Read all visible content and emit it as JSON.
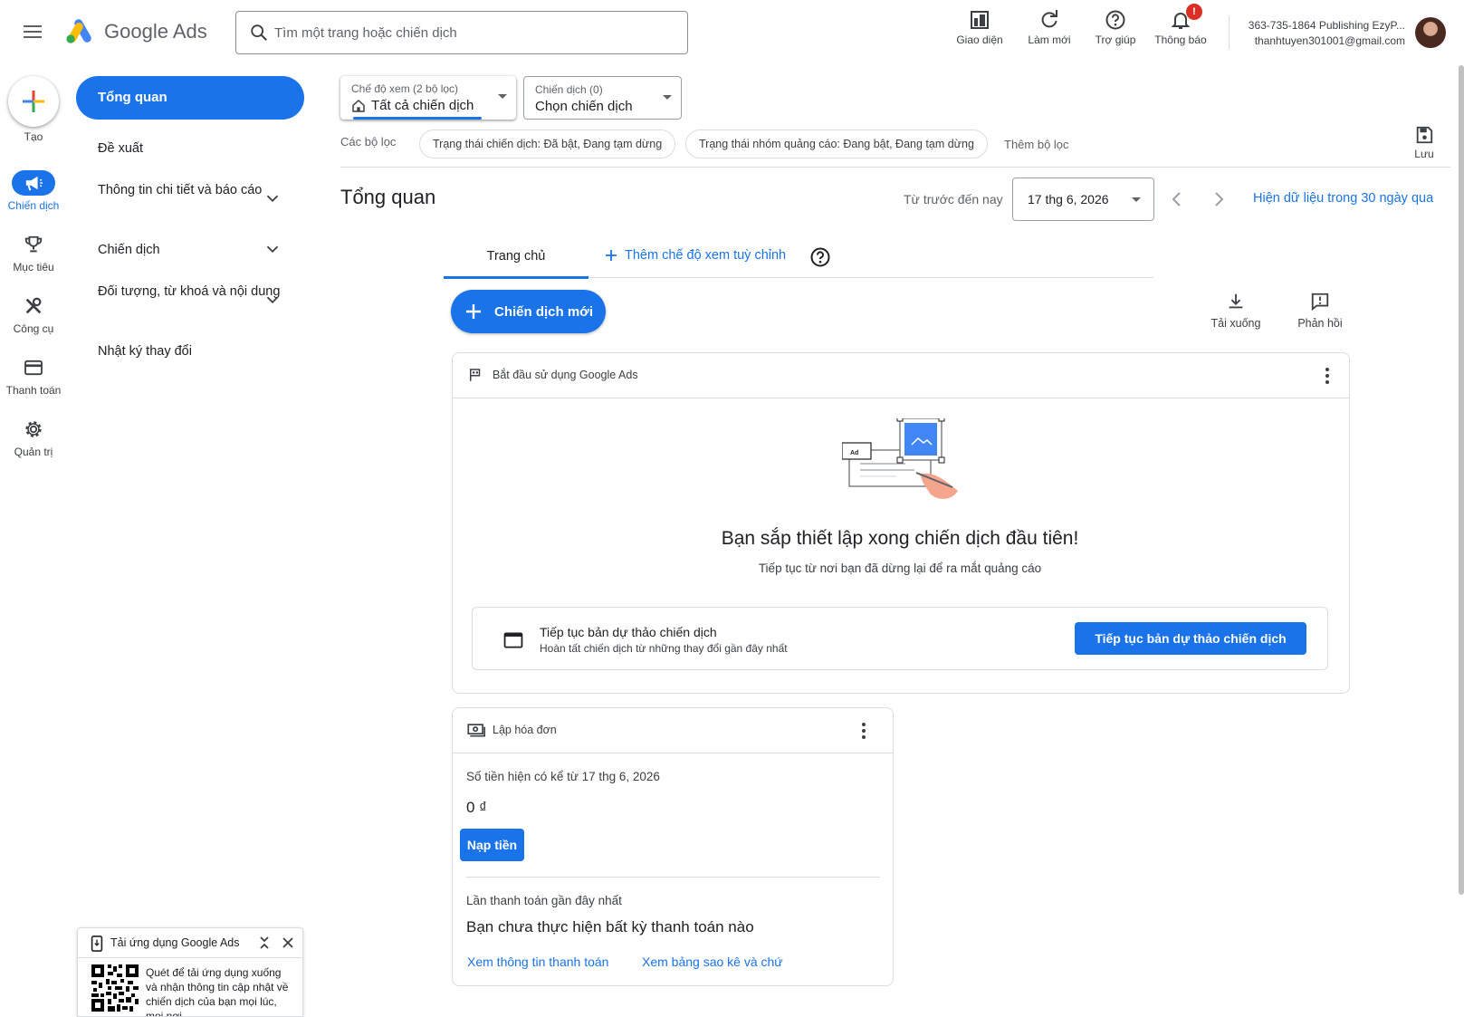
{
  "header": {
    "brand": "Google Ads",
    "search_placeholder": "Tìm một trang hoặc chiến dịch",
    "buttons": {
      "appearance": "Giao diện",
      "refresh": "Làm mới",
      "help": "Trợ giúp",
      "notifications": "Thông báo",
      "notifications_badge": "!"
    },
    "account": {
      "name": "363-735-1864 Publishing EzyP...",
      "email": "thanhtuyen301001@gmail.com"
    }
  },
  "rail": {
    "create": "Tạo",
    "items": [
      {
        "label": "Chiến dịch",
        "icon": "megaphone-icon",
        "active": true
      },
      {
        "label": "Mục tiêu",
        "icon": "trophy-icon"
      },
      {
        "label": "Công cụ",
        "icon": "tools-icon"
      },
      {
        "label": "Thanh toán",
        "icon": "credit-card-icon"
      },
      {
        "label": "Quản trị",
        "icon": "gear-icon"
      }
    ]
  },
  "nav": {
    "active": "Tổng quan",
    "items": [
      {
        "label": "Đề xuất"
      },
      {
        "label": "Thông tin chi tiết và báo cáo"
      },
      {
        "label": "Chiến dịch"
      },
      {
        "label": "Đối tượng, từ khoá và nội dung"
      },
      {
        "label": "Nhật ký thay đổi"
      }
    ]
  },
  "filters": {
    "view_caption": "Chế độ xem (2 bộ lọc)",
    "view_value": "Tất cả chiến dịch",
    "campaign_caption": "Chiến dịch (0)",
    "campaign_value": "Chọn chiến dịch",
    "label": "Các bộ lọc",
    "chips": [
      "Trạng thái chiến dịch: Đã bật, Đang tạm dừng",
      "Trạng thái nhóm quảng cáo: Đang bật, Đang tạm dừng"
    ],
    "add_filter": "Thêm bộ lọc",
    "save": "Lưu"
  },
  "title_row": {
    "title": "Tổng quan",
    "date_label": "Từ trước đến nay",
    "date_value": "17 thg 6, 2026",
    "range_link": "Hiện dữ liệu trong 30 ngày qua"
  },
  "tabs": {
    "home": "Trang chủ",
    "add_view": "Thêm chế độ xem tuỳ chỉnh"
  },
  "actions": {
    "new_campaign": "Chiến dịch mới",
    "download": "Tải xuống",
    "feedback": "Phản hồi"
  },
  "getting_started": {
    "header": "Bắt đầu sử dụng Google Ads",
    "illustration_tag": "Ad",
    "title": "Bạn sắp thiết lập xong chiến dịch đầu tiên!",
    "subtitle": "Tiếp tục từ nơi bạn đã dừng lại để ra mắt quảng cáo",
    "draft_title": "Tiếp tục bản dự thảo chiến dịch",
    "draft_subtitle": "Hoàn tất chiến dịch từ những thay đổi gần đây nhất",
    "draft_button": "Tiếp tục bản dự thảo chiến dịch"
  },
  "billing": {
    "header": "Lập hóa đơn",
    "available_label": "Số tiền hiện có kể từ 17 thg 6, 2026",
    "amount": "0 ₫",
    "topup": "Nạp tiền",
    "last_payment_label": "Lần thanh toán gần đây nhất",
    "no_payment": "Bạn chưa thực hiện bất kỳ thanh toán nào",
    "link_payment_info": "Xem thông tin thanh toán",
    "link_statements": "Xem bảng sao kê và chứ"
  },
  "app_promo": {
    "title": "Tải ứng dụng Google Ads",
    "description": "Quét để tải ứng dụng xuống và nhận thông tin cập nhật về chiến dịch của bạn mọi lúc, mọi nơi"
  },
  "colors": {
    "primary": "#1a73e8",
    "badge": "#d93025",
    "border": "#dadce0"
  }
}
